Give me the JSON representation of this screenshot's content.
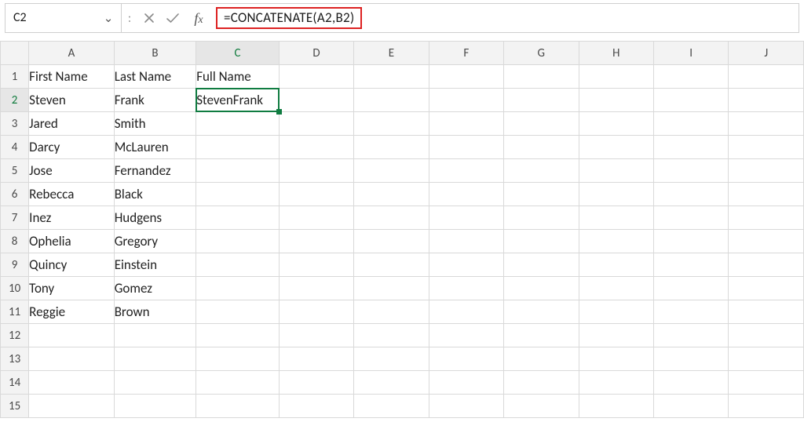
{
  "name_box": "C2",
  "formula_bar": "=CONCATENATE(A2,B2)",
  "columns": [
    "A",
    "B",
    "C",
    "D",
    "E",
    "F",
    "G",
    "H",
    "I",
    "J"
  ],
  "row_count": 15,
  "active_col": "C",
  "active_row": 2,
  "headers": {
    "A": "First Name",
    "B": "Last Name",
    "C": "Full Name"
  },
  "rows": [
    {
      "A": "Steven",
      "B": "Frank",
      "C": "StevenFrank"
    },
    {
      "A": "Jared",
      "B": "Smith",
      "C": ""
    },
    {
      "A": "Darcy",
      "B": "McLauren",
      "C": ""
    },
    {
      "A": "Jose",
      "B": "Fernandez",
      "C": ""
    },
    {
      "A": "Rebecca",
      "B": "Black",
      "C": ""
    },
    {
      "A": "Inez",
      "B": "Hudgens",
      "C": ""
    },
    {
      "A": "Ophelia",
      "B": "Gregory",
      "C": ""
    },
    {
      "A": "Quincy",
      "B": "Einstein",
      "C": ""
    },
    {
      "A": "Tony",
      "B": "Gomez",
      "C": ""
    },
    {
      "A": "Reggie",
      "B": "Brown",
      "C": ""
    }
  ],
  "glyphs": {
    "dropdown": "⌄",
    "separator": ":"
  }
}
